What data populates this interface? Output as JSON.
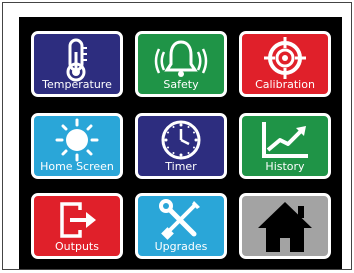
{
  "tiles": [
    {
      "label": "Temperature",
      "icon": "thermometer-icon",
      "color": "#2d2d7f"
    },
    {
      "label": "Safety",
      "icon": "bell-alarm-icon",
      "color": "#1f9447"
    },
    {
      "label": "Calibration",
      "icon": "crosshair-target-icon",
      "color": "#e0202a"
    },
    {
      "label": "Home Screen",
      "icon": "sun-icon",
      "color": "#2aa6d8"
    },
    {
      "label": "Timer",
      "icon": "clock-icon",
      "color": "#2d2d7f"
    },
    {
      "label": "History",
      "icon": "trend-chart-icon",
      "color": "#1f9447"
    },
    {
      "label": "Outputs",
      "icon": "output-arrow-icon",
      "color": "#e0202a"
    },
    {
      "label": "Upgrades",
      "icon": "wrench-screwdriver-icon",
      "color": "#2aa6d8"
    },
    {
      "label": "",
      "icon": "home-icon",
      "color": "#a3a3a3"
    }
  ]
}
